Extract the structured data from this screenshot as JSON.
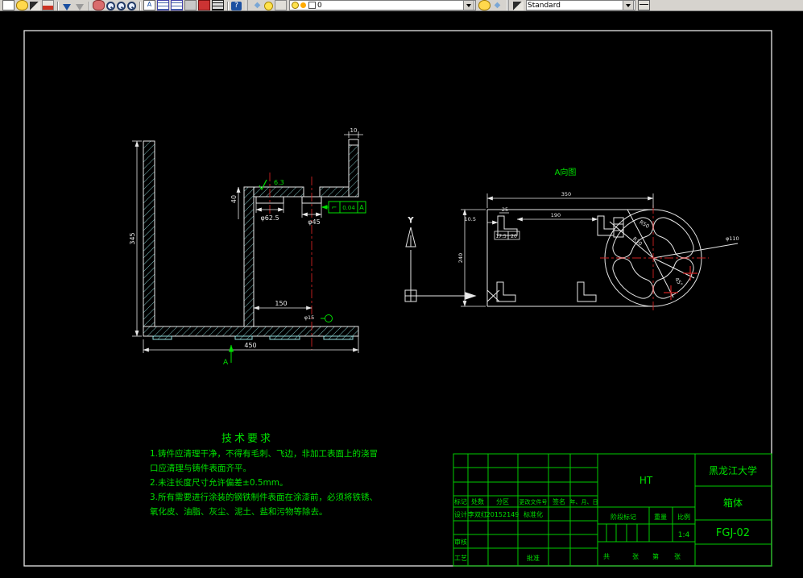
{
  "window": {
    "layer_value": "0",
    "style_value": "Standard"
  },
  "views": {
    "section": {
      "dims": {
        "height": "345",
        "width": "450",
        "inner": "150",
        "web": "40",
        "wall": "10",
        "bore": "φ62.5",
        "hole": "φ45",
        "boss_hole": "φ15",
        "roughness": "6.3"
      },
      "tolerance": {
        "symbol": "⌐",
        "value": "0.04",
        "datum": "A"
      },
      "section_label": "A"
    },
    "a_view": {
      "title": "A向图",
      "dims": {
        "width": "350",
        "height": "240",
        "spacing": "190",
        "d25": "25",
        "d105": "10.5",
        "d175": "17.5",
        "d20": "20",
        "r_inner": "R30",
        "r_outer": "R50",
        "callout": "φ110",
        "angle": "45°"
      },
      "axis_y": "Y"
    }
  },
  "tech_requirements": {
    "title": "技术要求",
    "lines": [
      "1.铸件应清理干净，不得有毛刺、飞边，非加工表面上的浇冒",
      "口应清理与铸件表面齐平。",
      "2.未注长度尺寸允许偏差±0.5mm。",
      "3.所有需要进行涂装的钢铁制件表面在涂漆前，必须将铁锈、",
      "氧化皮、油脂、灰尘、泥土、盐和污物等除去。"
    ]
  },
  "title_block": {
    "headers": [
      "标记",
      "处数",
      "分区",
      "更改文件号",
      "签名",
      "年、月、日"
    ],
    "design_label": "设计",
    "designer": "李双红",
    "student_no": "20152149",
    "standard_label": "标准化",
    "review_label": "审核",
    "process_label": "工艺",
    "approve_label": "批准",
    "material": "HT",
    "stage_label": "阶段标记",
    "weight_label": "重量",
    "scale_label": "比例",
    "scale_value": "1:4",
    "sheet_label_1": "共",
    "sheet_label_2": "张",
    "sheet_label_3": "第",
    "sheet_label_4": "张",
    "university": "黑龙江大学",
    "part_name": "箱体",
    "drawing_no": "FGJ-02"
  }
}
